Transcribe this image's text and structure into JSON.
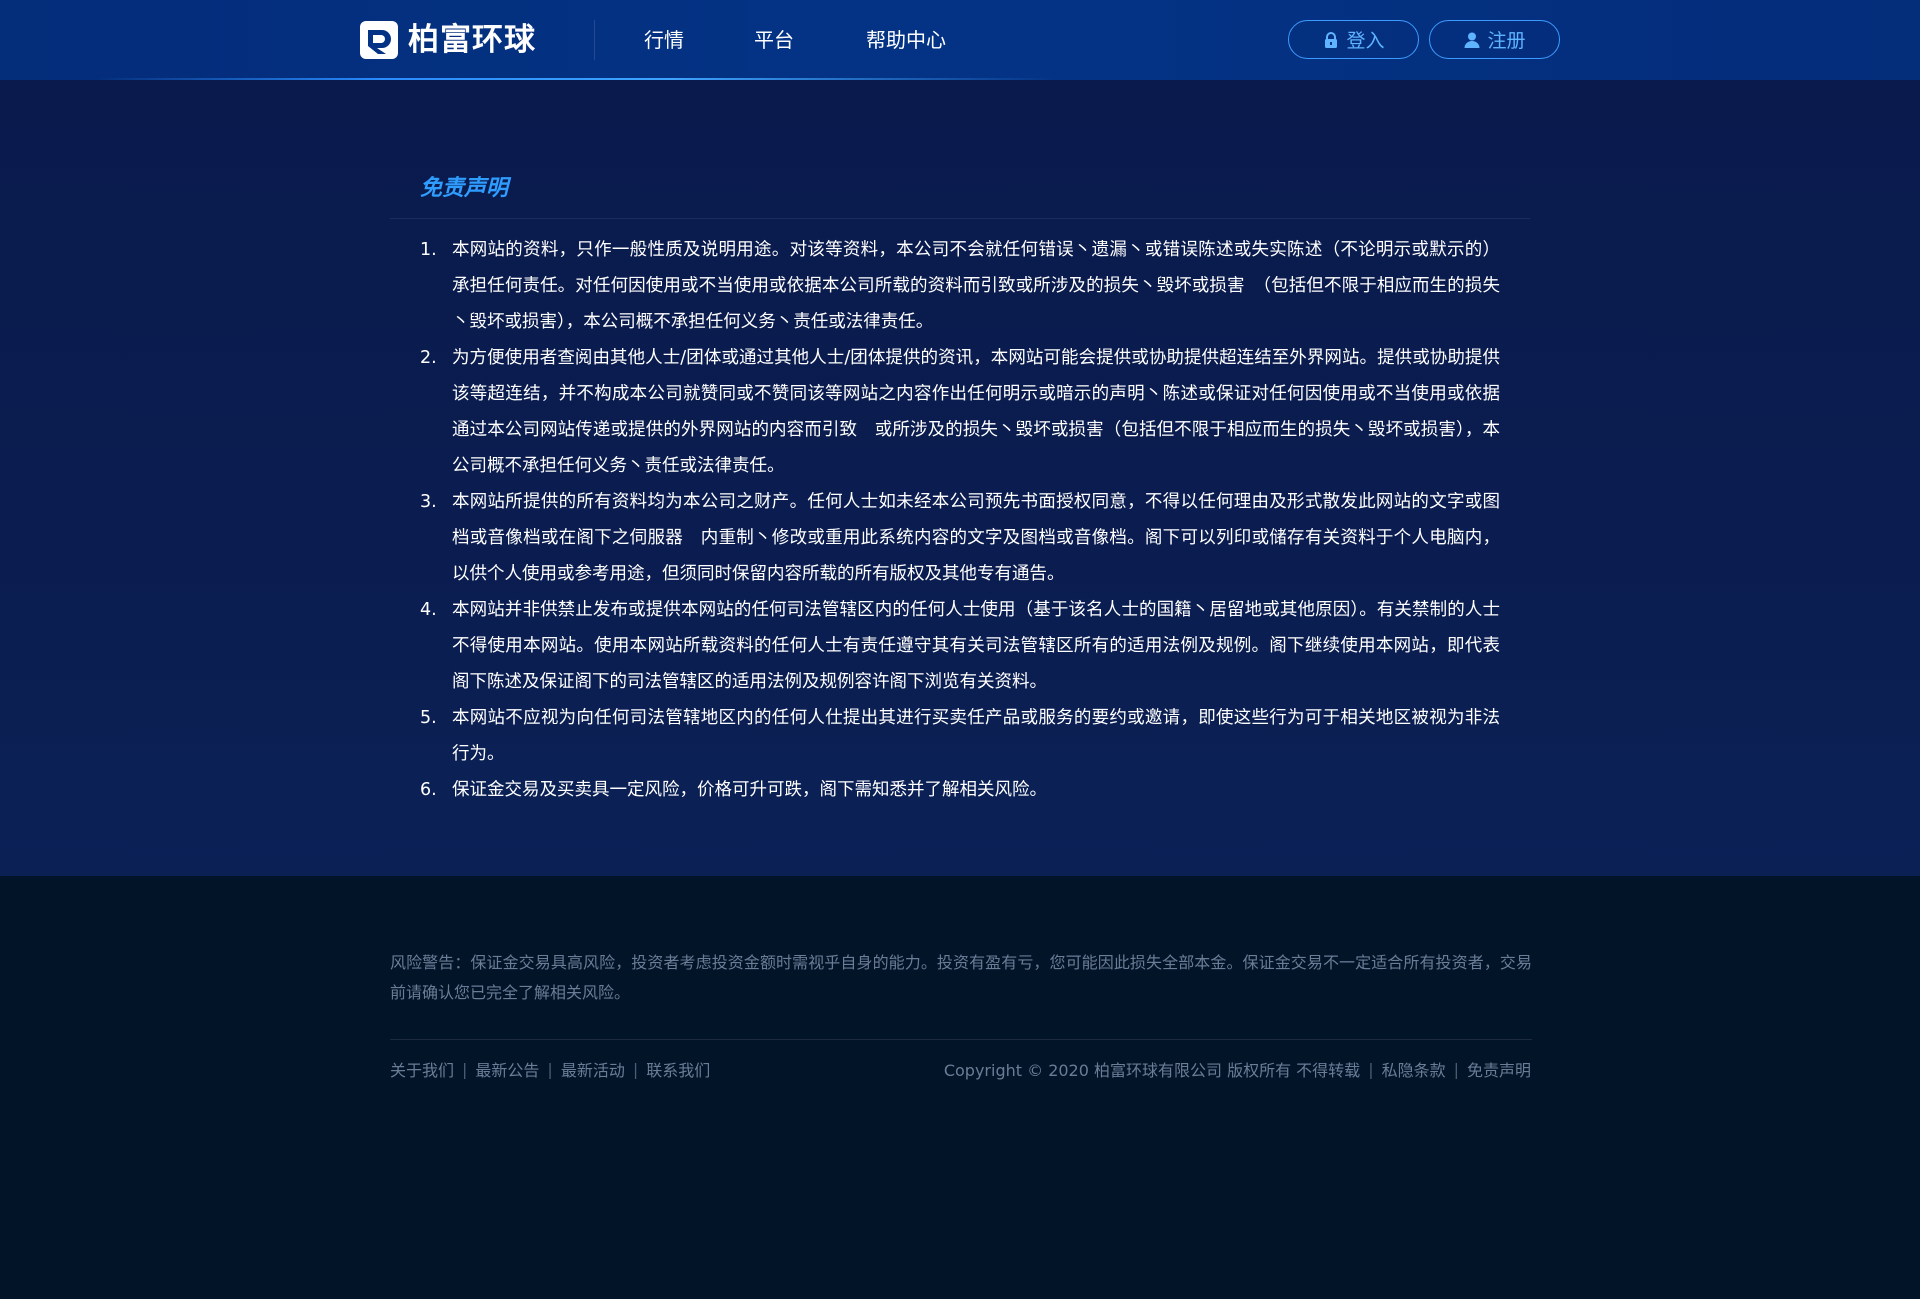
{
  "header": {
    "logo_text": "柏富环球",
    "nav": [
      {
        "label": "行情"
      },
      {
        "label": "平台"
      },
      {
        "label": "帮助中心"
      }
    ],
    "login_label": "登入",
    "register_label": "注册",
    "icons": {
      "login": "lock-icon",
      "register": "user-icon",
      "logo": "logo-mark-icon"
    }
  },
  "main": {
    "title": "免责声明",
    "items": [
      {
        "num": "1.",
        "text": "本网站的资料，只作一般性质及说明用途。对该等资料，本公司不会就任何错误丶遗漏丶或错误陈述或失实陈述（不论明示或默示的）承担任何责任。对任何因使用或不当使用或依据本公司所载的资料而引致或所涉及的损失丶毁坏或损害　（包括但不限于相应而生的损失丶毁坏或损害），本公司概不承担任何义务丶责任或法律责任。"
      },
      {
        "num": "2.",
        "text": "为方便使用者查阅由其他人士/团体或通过其他人士/团体提供的资讯，本网站可能会提供或协助提供超连结至外界网站。提供或协助提供该等超连结，并不构成本公司就赞同或不赞同该等网站之内容作出任何明示或暗示的声明丶陈述或保证对任何因使用或不当使用或依据通过本公司网站传递或提供的外界网站的内容而引致　或所涉及的损失丶毁坏或损害（包括但不限于相应而生的损失丶毁坏或损害），本公司概不承担任何义务丶责任或法律责任。"
      },
      {
        "num": "3.",
        "text": "本网站所提供的所有资料均为本公司之财产。任何人士如未经本公司预先书面授权同意，不得以任何理由及形式散发此网站的文字或图档或音像档或在阁下之伺服器　内重制丶修改或重用此系统内容的文字及图档或音像档。阁下可以列印或储存有关资料于个人电脑内，以供个人使用或参考用途，但须同时保留内容所载的所有版权及其他专有通告。"
      },
      {
        "num": "4.",
        "text": "本网站并非供禁止发布或提供本网站的任何司法管辖区内的任何人士使用（基于该名人士的国籍丶居留地或其他原因）。有关禁制的人士不得使用本网站。使用本网站所载资料的任何人士有责任遵守其有关司法管辖区所有的适用法例及规例。阁下继续使用本网站，即代表阁下陈述及保证阁下的司法管辖区的适用法例及规例容许阁下浏览有关资料。"
      },
      {
        "num": "5.",
        "text": "本网站不应视为向任何司法管辖地区内的任何人仕提出其进行买卖任产品或服务的要约或邀请，即使这些行为可于相关地区被视为非法行为。"
      },
      {
        "num": "6.",
        "text": "保证金交易及买卖具一定风险，价格可升可跌，阁下需知悉并了解相关风险。"
      }
    ]
  },
  "footer": {
    "risk_warning": "风险警告：保证金交易具高风险，投资者考虑投资金额时需视乎自身的能力。投资有盈有亏，您可能因此损失全部本金。保证金交易不一定适合所有投资者，交易前请确认您已完全了解相关风险。",
    "links": [
      "关于我们",
      "最新公告",
      "最新活动",
      "联系我们"
    ],
    "separator": "|",
    "copyright": "Copyright © 2020 柏富环球有限公司  版权所有 不得转载",
    "legal_links": [
      "私隐条款",
      "免责声明"
    ]
  },
  "colors": {
    "header_bg": "#043386",
    "main_bg": "#0b1d50",
    "footer_bg": "#021428",
    "accent": "#2e9dff",
    "footer_text": "#6b7c96"
  }
}
